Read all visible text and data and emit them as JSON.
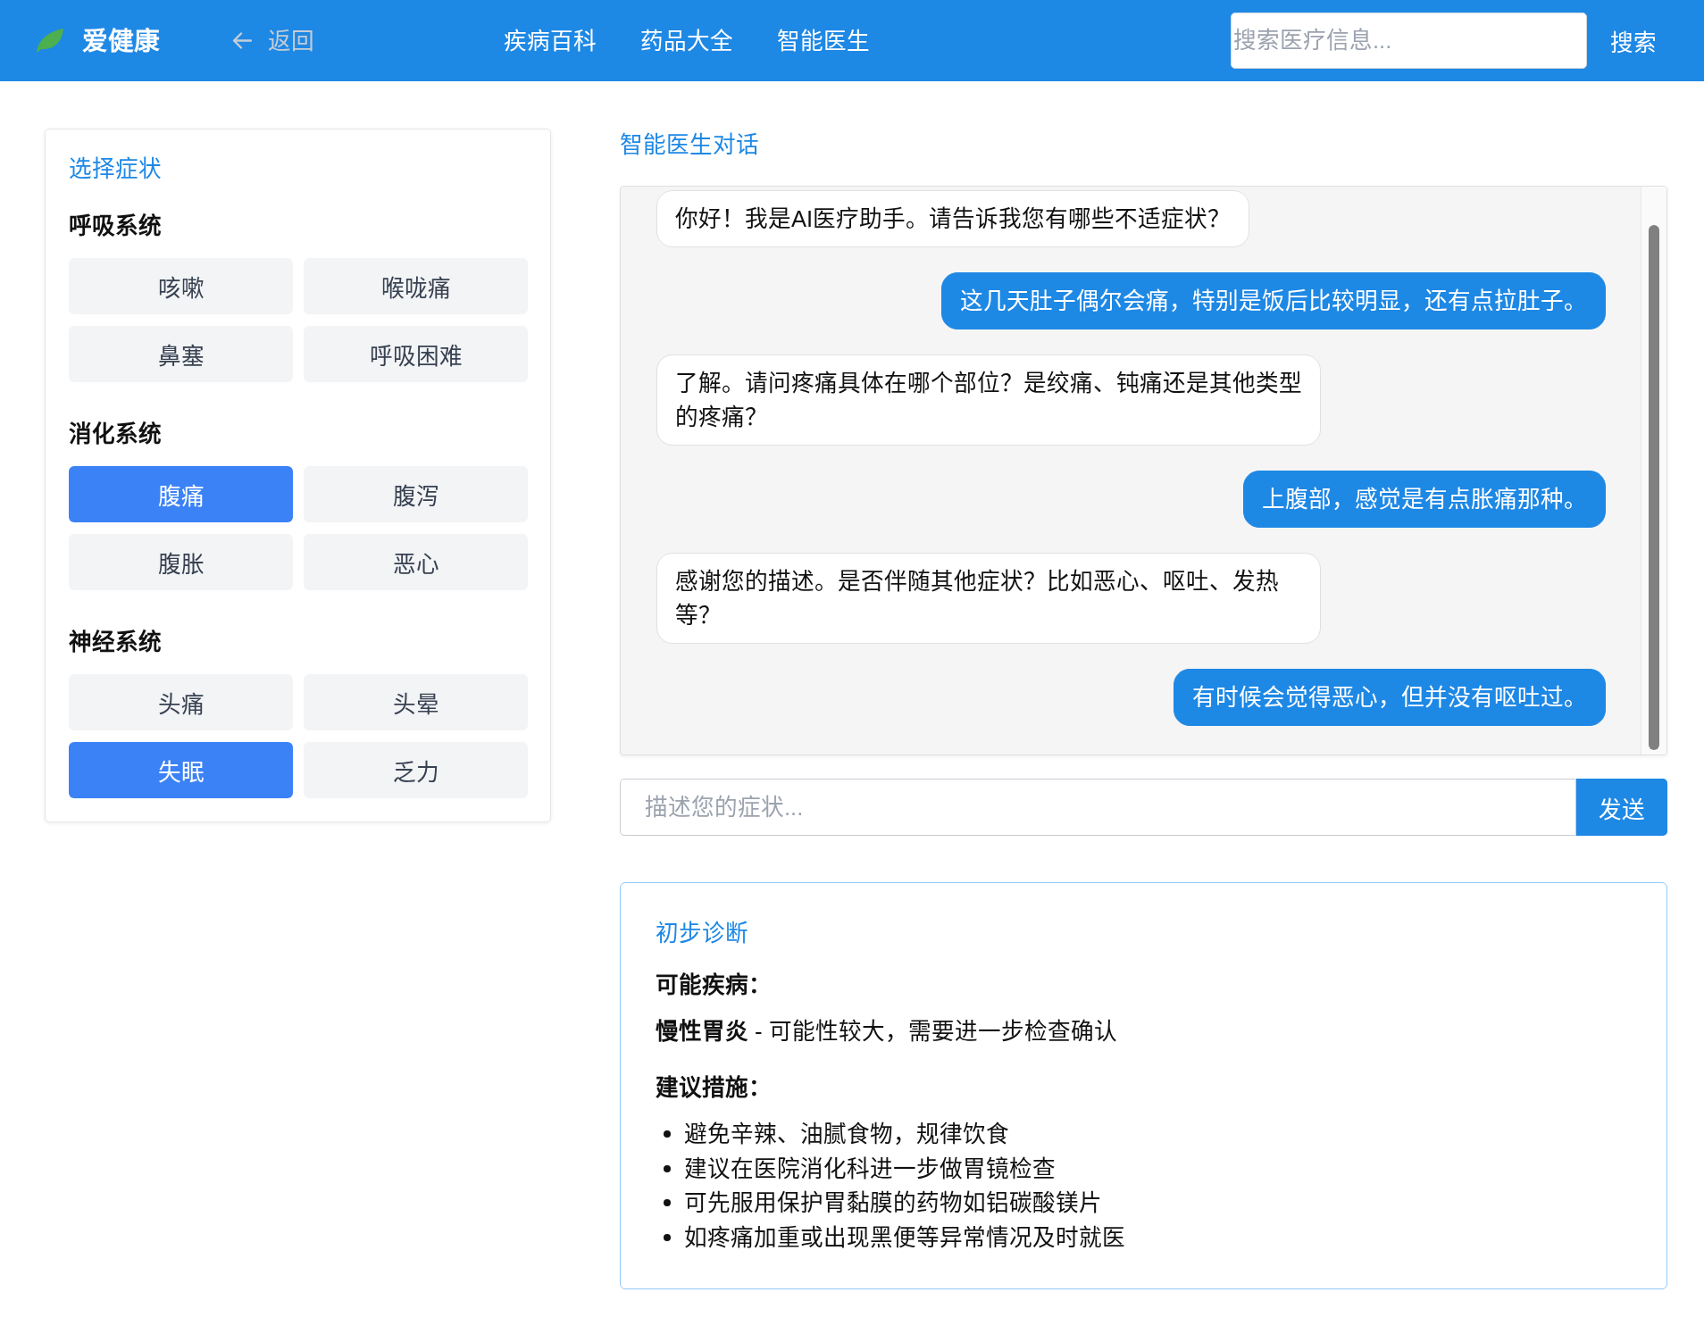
{
  "header": {
    "logo": "爱健康",
    "back": "返回",
    "nav": [
      "疾病百科",
      "药品大全",
      "智能医生"
    ],
    "search": {
      "placeholder": "搜索医疗信息...",
      "button": "搜索"
    }
  },
  "symptom_panel": {
    "title": "选择症状",
    "groups": [
      {
        "name": "呼吸系统",
        "symptoms": [
          {
            "label": "咳嗽",
            "selected": false
          },
          {
            "label": "喉咙痛",
            "selected": false
          },
          {
            "label": "鼻塞",
            "selected": false
          },
          {
            "label": "呼吸困难",
            "selected": false
          }
        ]
      },
      {
        "name": "消化系统",
        "symptoms": [
          {
            "label": "腹痛",
            "selected": true
          },
          {
            "label": "腹泻",
            "selected": false
          },
          {
            "label": "腹胀",
            "selected": false
          },
          {
            "label": "恶心",
            "selected": false
          }
        ]
      },
      {
        "name": "神经系统",
        "symptoms": [
          {
            "label": "头痛",
            "selected": false
          },
          {
            "label": "头晕",
            "selected": false
          },
          {
            "label": "失眠",
            "selected": true
          },
          {
            "label": "乏力",
            "selected": false
          }
        ]
      }
    ]
  },
  "chat": {
    "title": "智能医生对话",
    "messages": [
      {
        "kind": "incoming",
        "text": "你好！我是AI医疗助手。请告诉我您有哪些不适症状？"
      },
      {
        "kind": "outgoing",
        "text": "这几天肚子偶尔会痛，特别是饭后比较明显，还有点拉肚子。"
      },
      {
        "kind": "incoming",
        "text": "了解。请问疼痛具体在哪个部位？是绞痛、钝痛还是其他类型的疼痛？"
      },
      {
        "kind": "outgoing",
        "text": "上腹部，感觉是有点胀痛那种。"
      },
      {
        "kind": "incoming",
        "text": "感谢您的描述。是否伴随其他症状？比如恶心、呕吐、发热等？"
      },
      {
        "kind": "outgoing",
        "text": "有时候会觉得恶心，但并没有呕吐过。"
      }
    ],
    "input": {
      "placeholder": "描述您的症状..."
    },
    "send_button": "发送"
  },
  "diagnosis": {
    "title": "初步诊断",
    "conditions_heading": "可能疾病：",
    "condition": "**慢性胃炎** - 可能性较大，需要进一步检查确认",
    "advice_heading": "建议措施：",
    "advice": [
      "避免辛辣、油腻食物，规律饮食",
      "建议在医院消化科进一步做胃镜检查",
      "可先服用保护胃黏膜的药物如铝碳酸镁片",
      "如疼痛加重或出现黑便等异常情况及时就医"
    ]
  }
}
